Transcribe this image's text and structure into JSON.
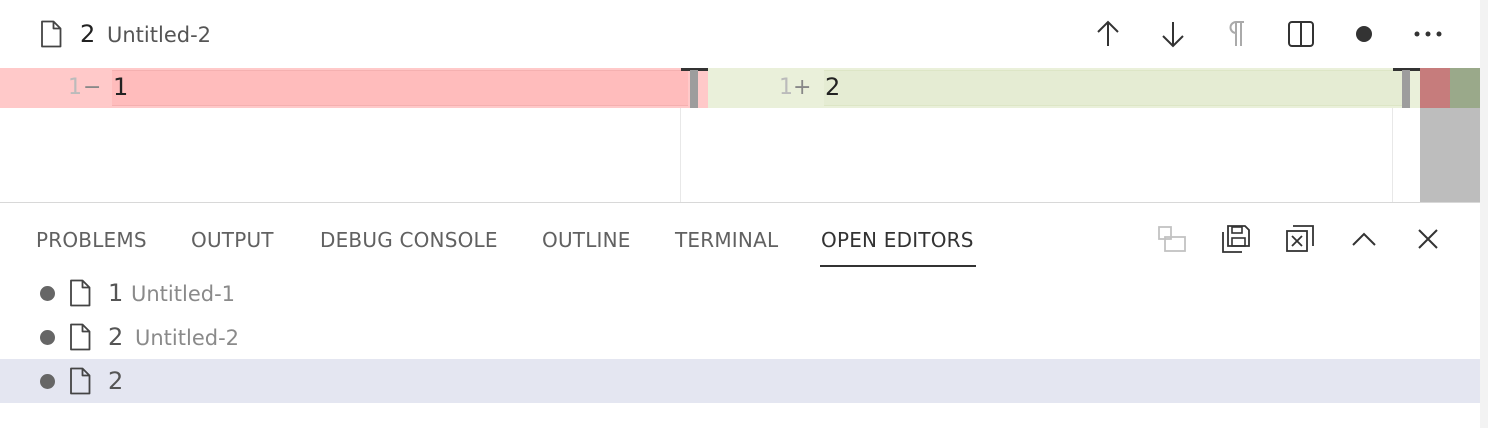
{
  "editor_tab": {
    "icon": "file-icon",
    "name": "2",
    "description": "Untitled-2"
  },
  "editor_actions": [
    {
      "name": "previous-change-button",
      "icon": "arrow-up-icon"
    },
    {
      "name": "next-change-button",
      "icon": "arrow-down-icon"
    },
    {
      "name": "toggle-whitespace-button",
      "icon": "pilcrow-icon"
    },
    {
      "name": "split-editor-button",
      "icon": "split-editor-icon"
    },
    {
      "name": "unsaved-indicator",
      "icon": "dot-icon"
    },
    {
      "name": "more-actions-button",
      "icon": "ellipsis-icon"
    }
  ],
  "diff": {
    "original": {
      "line_number": "1",
      "sign": "−",
      "text": "1"
    },
    "modified": {
      "line_number": "1",
      "sign": "+",
      "text": "2"
    },
    "colors": {
      "removed": "#ffc9c9",
      "added": "#eaf0da"
    }
  },
  "panel": {
    "tabs": [
      "PROBLEMS",
      "OUTPUT",
      "DEBUG CONSOLE",
      "OUTLINE",
      "TERMINAL",
      "OPEN EDITORS"
    ],
    "active_tab": "OPEN EDITORS",
    "actions": [
      {
        "name": "toggle-vertical-layout-button",
        "icon": "layout-icon",
        "enabled": false
      },
      {
        "name": "save-all-button",
        "icon": "save-all-icon",
        "enabled": true
      },
      {
        "name": "close-all-button",
        "icon": "close-all-icon",
        "enabled": true
      },
      {
        "name": "maximize-panel-button",
        "icon": "chevron-up-icon",
        "enabled": true
      },
      {
        "name": "close-panel-button",
        "icon": "close-icon",
        "enabled": true
      }
    ]
  },
  "open_editors": [
    {
      "name": "1",
      "description": "Untitled-1",
      "dirty": true,
      "selected": false
    },
    {
      "name": "2",
      "description": "Untitled-2",
      "dirty": true,
      "selected": false
    },
    {
      "name": "2",
      "description": "",
      "dirty": true,
      "selected": true
    }
  ]
}
